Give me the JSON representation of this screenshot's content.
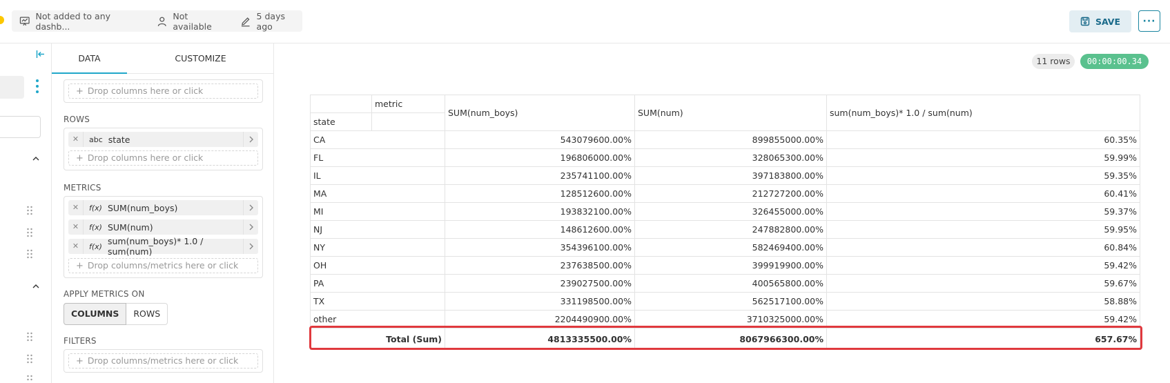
{
  "header": {
    "dashboards_text": "Not added to any dashb...",
    "owner_text": "Not available",
    "modified_text": "5 days ago",
    "save_label": "SAVE",
    "more_label": "···"
  },
  "control_panel": {
    "tabs": [
      {
        "label": "DATA",
        "active": true
      },
      {
        "label": "CUSTOMIZE",
        "active": false
      }
    ],
    "columns_drop_hint": "Drop columns here or click",
    "rows_label": "ROWS",
    "rows_chips": [
      {
        "type": "abc",
        "label": "state"
      }
    ],
    "rows_drop_hint": "Drop columns here or click",
    "metrics_label": "METRICS",
    "metrics_chips": [
      {
        "type": "f(x)",
        "label": "SUM(num_boys)"
      },
      {
        "type": "f(x)",
        "label": "SUM(num)"
      },
      {
        "type": "f(x)",
        "label": "sum(num_boys)* 1.0 / sum(num)"
      }
    ],
    "metrics_drop_hint": "Drop columns/metrics here or click",
    "apply_label": "APPLY METRICS ON",
    "apply_options": [
      "COLUMNS",
      "ROWS"
    ],
    "filters_label": "FILTERS",
    "filters_drop_hint": "Drop columns/metrics here or click"
  },
  "results": {
    "row_count": "11 rows",
    "timer": "00:00:00.34",
    "table": {
      "corner_col_label": "metric",
      "corner_row_label": "state",
      "columns": [
        "SUM(num_boys)",
        "SUM(num)",
        "sum(num_boys)* 1.0 / sum(num)"
      ],
      "rows": [
        {
          "state": "CA",
          "values": [
            "543079600.00%",
            "899855000.00%",
            "60.35%"
          ]
        },
        {
          "state": "FL",
          "values": [
            "196806000.00%",
            "328065300.00%",
            "59.99%"
          ]
        },
        {
          "state": "IL",
          "values": [
            "235741100.00%",
            "397183800.00%",
            "59.35%"
          ]
        },
        {
          "state": "MA",
          "values": [
            "128512600.00%",
            "212727200.00%",
            "60.41%"
          ]
        },
        {
          "state": "MI",
          "values": [
            "193832100.00%",
            "326455000.00%",
            "59.37%"
          ]
        },
        {
          "state": "NJ",
          "values": [
            "148612600.00%",
            "247882800.00%",
            "59.95%"
          ]
        },
        {
          "state": "NY",
          "values": [
            "354396100.00%",
            "582469400.00%",
            "60.84%"
          ]
        },
        {
          "state": "OH",
          "values": [
            "237638500.00%",
            "399919900.00%",
            "59.42%"
          ]
        },
        {
          "state": "PA",
          "values": [
            "239027500.00%",
            "400565800.00%",
            "59.67%"
          ]
        },
        {
          "state": "TX",
          "values": [
            "331198500.00%",
            "562517100.00%",
            "58.88%"
          ]
        },
        {
          "state": "other",
          "values": [
            "2204490900.00%",
            "3710325000.00%",
            "59.42%"
          ]
        }
      ],
      "total": {
        "label": "Total (Sum)",
        "values": [
          "4813335500.00%",
          "8067966300.00%",
          "657.67%"
        ]
      }
    }
  },
  "colors": {
    "accent": "#20a7c9",
    "value_text": "#1a6a8a",
    "timer_bg": "#5ac18e",
    "highlight": "#e0393e"
  }
}
